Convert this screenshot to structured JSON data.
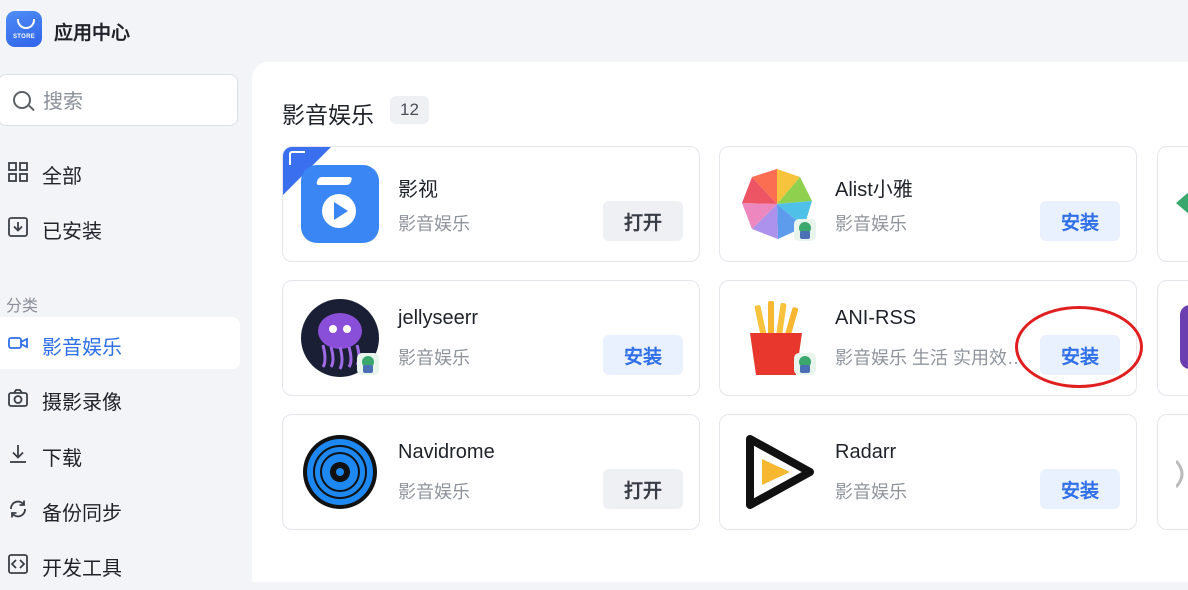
{
  "app": {
    "title": "应用中心",
    "logo_text": "STORE"
  },
  "search": {
    "placeholder": "搜索",
    "value": ""
  },
  "sidebar": {
    "items": [
      {
        "label": "全部",
        "icon": "grid-icon"
      },
      {
        "label": "已安装",
        "icon": "download-box-icon"
      }
    ],
    "section_label": "分类",
    "categories": [
      {
        "label": "影音娱乐",
        "icon": "video-camera-icon",
        "active": true
      },
      {
        "label": "摄影录像",
        "icon": "camera-icon"
      },
      {
        "label": "下载",
        "icon": "download-icon"
      },
      {
        "label": "备份同步",
        "icon": "sync-icon"
      },
      {
        "label": "开发工具",
        "icon": "code-icon"
      }
    ]
  },
  "main": {
    "category_title": "影音娱乐",
    "category_count": "12",
    "apps": [
      {
        "name": "影视",
        "category": "影音娱乐",
        "action": "打开",
        "action_type": "open",
        "icon": "yingshi-icon"
      },
      {
        "name": "Alist小雅",
        "category": "影音娱乐",
        "action": "安装",
        "action_type": "install",
        "icon": "alist-xiaoya-icon"
      },
      {
        "name": "jellyseerr",
        "category": "影音娱乐",
        "action": "安装",
        "action_type": "install",
        "icon": "jellyseerr-icon"
      },
      {
        "name": "ANI-RSS",
        "category": "影音娱乐 生活 实用效…",
        "action": "安装",
        "action_type": "install",
        "icon": "ani-rss-icon"
      },
      {
        "name": "Navidrome",
        "category": "影音娱乐",
        "action": "打开",
        "action_type": "open",
        "icon": "navidrome-icon"
      },
      {
        "name": "Radarr",
        "category": "影音娱乐",
        "action": "安装",
        "action_type": "install",
        "icon": "radarr-icon"
      }
    ]
  },
  "colors": {
    "accent": "#2f6fe8",
    "install_bg": "#eaf1fe",
    "open_bg": "#eef0f4",
    "highlight_annotation": "#e02020"
  }
}
